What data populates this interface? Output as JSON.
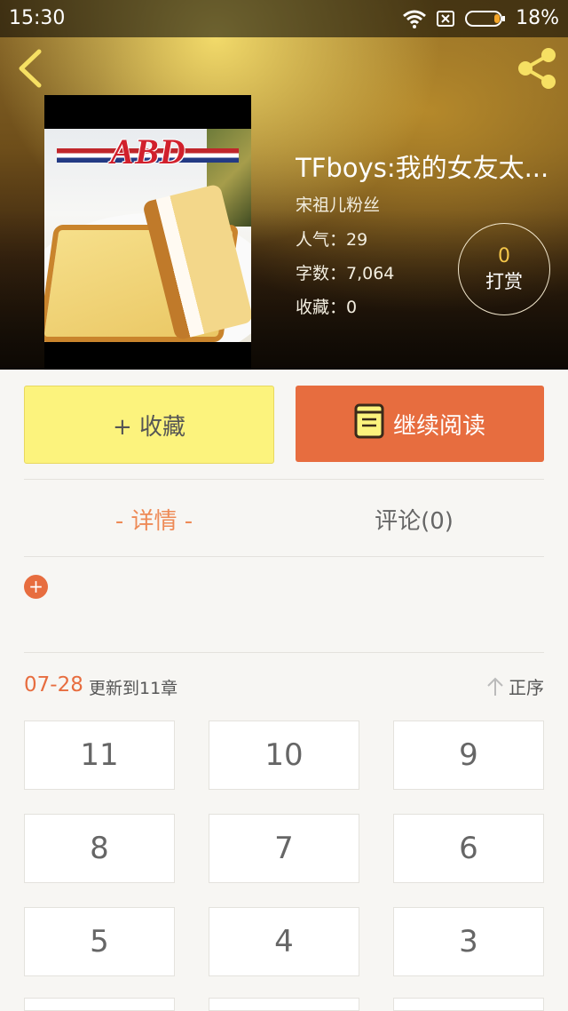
{
  "status_bar": {
    "time": "15:30",
    "battery": "18%",
    "icons": [
      "wifi-icon",
      "sim-icon",
      "battery-icon"
    ]
  },
  "header": {
    "back_icon": "chevron-left-icon",
    "share_icon": "share-icon"
  },
  "cover": {
    "logo_text": "ABD"
  },
  "book": {
    "title": "TFboys:我的女友太...",
    "author": "宋祖儿粉丝",
    "popularity": "人气：29",
    "word_count": "字数：7,064",
    "favorites": "收藏：0"
  },
  "reward": {
    "count": "0",
    "label": "打赏"
  },
  "actions": {
    "collect_label": "+ 收藏",
    "read_label": "继续阅读"
  },
  "tabs": {
    "details": "- 详情 -",
    "comments": "评论(0)"
  },
  "update": {
    "date": "07-28",
    "text": "更新到11章",
    "sort_label": "正序"
  },
  "chapters": [
    "11",
    "10",
    "9",
    "8",
    "7",
    "6",
    "5",
    "4",
    "3"
  ],
  "colors": {
    "accent": "#e76d3f",
    "collect": "#fcf37d",
    "tab_active": "#ee8a56",
    "reward_count": "#f4c64a"
  }
}
